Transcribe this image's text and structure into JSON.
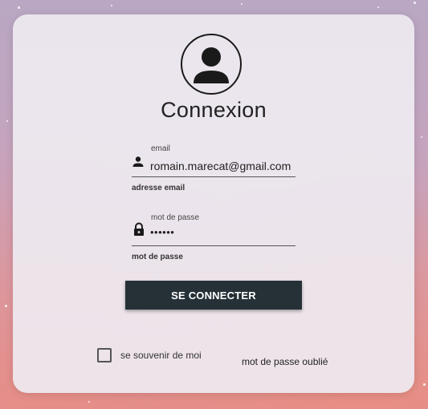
{
  "login": {
    "title": "Connexion",
    "email": {
      "floating_label": "email",
      "value": "romain.marecat@gmail.com",
      "helper": "adresse email"
    },
    "password": {
      "floating_label": "mot de passe",
      "value": "••••••",
      "helper": "mot de passe"
    },
    "submit_label": "SE CONNECTER",
    "remember_me_label": "se souvenir de moi",
    "forgot_password_label": "mot de passe oublié"
  },
  "icons": {
    "avatar": "account-circle-icon",
    "email": "person-icon",
    "password": "lock-icon"
  },
  "colors": {
    "button_bg": "#253137",
    "button_text": "#ffffff",
    "card_bg": "#eeeaf0"
  }
}
